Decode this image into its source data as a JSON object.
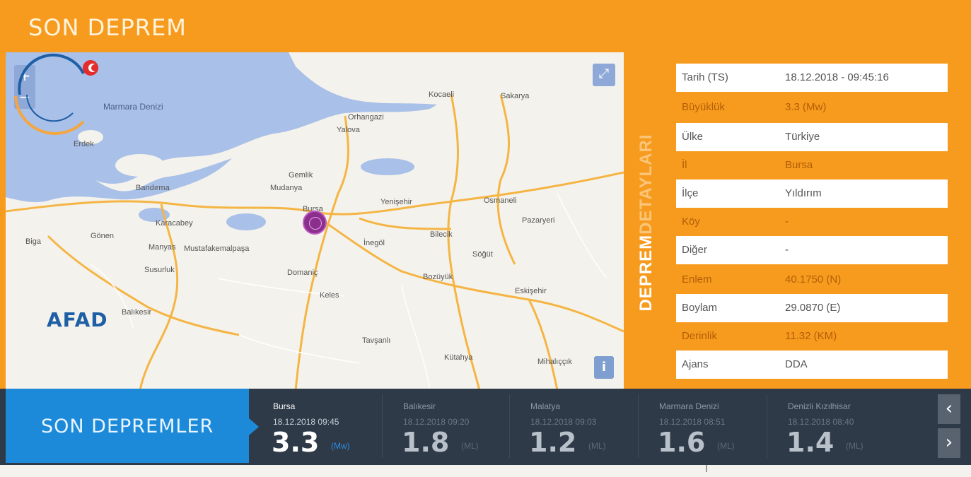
{
  "header": {
    "title": "SON DEPREM"
  },
  "map": {
    "zoom_in": "+",
    "zoom_out": "−",
    "fullscreen": "⤢",
    "info": "i",
    "labels": [
      {
        "text": "Marmara Denizi",
        "kind": "sea"
      },
      {
        "text": "Bursa",
        "kind": "city"
      },
      {
        "text": "Bilecik",
        "kind": "city"
      },
      {
        "text": "Kütahya",
        "kind": "city"
      },
      {
        "text": "Balıkesir",
        "kind": "city"
      },
      {
        "text": "Eskişehir",
        "kind": "city"
      },
      {
        "text": "İnegöl",
        "kind": "city"
      },
      {
        "text": "Yenişehir",
        "kind": "city"
      },
      {
        "text": "Orhangazi",
        "kind": "city"
      },
      {
        "text": "Gemlik",
        "kind": "city"
      },
      {
        "text": "Mudanya",
        "kind": "city"
      },
      {
        "text": "Karacabey",
        "kind": "city"
      },
      {
        "text": "Mustafakemalpaşa",
        "kind": "city"
      },
      {
        "text": "Susurluk",
        "kind": "city"
      },
      {
        "text": "Keles",
        "kind": "city"
      },
      {
        "text": "Domaniç",
        "kind": "city"
      },
      {
        "text": "Tavşanlı",
        "kind": "city"
      },
      {
        "text": "Bozüyük",
        "kind": "city"
      },
      {
        "text": "Söğüt",
        "kind": "city"
      },
      {
        "text": "Osmaneli",
        "kind": "city"
      },
      {
        "text": "Pazaryeri",
        "kind": "city"
      },
      {
        "text": "Mihalıççık",
        "kind": "city"
      },
      {
        "text": "Sakarya",
        "kind": "city"
      },
      {
        "text": "Kocaeli",
        "kind": "city"
      },
      {
        "text": "Yalova",
        "kind": "city"
      },
      {
        "text": "Bandırma",
        "kind": "city"
      },
      {
        "text": "Erdek",
        "kind": "city"
      },
      {
        "text": "Biga",
        "kind": "city"
      },
      {
        "text": "Gönen",
        "kind": "city"
      },
      {
        "text": "Manyas",
        "kind": "city"
      }
    ],
    "logo_text": "AFAD"
  },
  "vertical_label": {
    "strong": "DEPREM",
    "light": "DETAYLARI"
  },
  "details": [
    {
      "key": "Tarih (TS)",
      "value": "18.12.2018 - 09:45:16",
      "style": "white"
    },
    {
      "key": "Büyüklük",
      "value": "3.3 (Mw)",
      "style": "orange"
    },
    {
      "key": "Ülke",
      "value": "Türkiye",
      "style": "white"
    },
    {
      "key": "İl",
      "value": "Bursa",
      "style": "orange"
    },
    {
      "key": "İlçe",
      "value": "Yıldırım",
      "style": "white"
    },
    {
      "key": "Köy",
      "value": "-",
      "style": "orange"
    },
    {
      "key": "Diğer",
      "value": "-",
      "style": "white"
    },
    {
      "key": "Enlem",
      "value": "40.1750 (N)",
      "style": "orange"
    },
    {
      "key": "Boylam",
      "value": "29.0870 (E)",
      "style": "white"
    },
    {
      "key": "Derinlik",
      "value": "11.32 (KM)",
      "style": "orange"
    },
    {
      "key": "Ajans",
      "value": "DDA",
      "style": "white"
    }
  ],
  "bottom": {
    "title": "SON DEPREMLER",
    "quakes": [
      {
        "place": "Bursa",
        "date": "18.12.2018 09:45",
        "magnitude": "3.3",
        "unit": "(Mw)"
      },
      {
        "place": "Balıkesir",
        "date": "18.12.2018 09:20",
        "magnitude": "1.8",
        "unit": "(ML)"
      },
      {
        "place": "Malatya",
        "date": "18.12.2018 09:03",
        "magnitude": "1.2",
        "unit": "(ML)"
      },
      {
        "place": "Marmara Denizi",
        "date": "18.12.2018 08:51",
        "magnitude": "1.6",
        "unit": "(ML)"
      },
      {
        "place": "Denizli Kızılhisar",
        "date": "18.12.2018 08:40",
        "magnitude": "1.4",
        "unit": "(ML)"
      }
    ],
    "prev": "‹",
    "next": "›"
  }
}
